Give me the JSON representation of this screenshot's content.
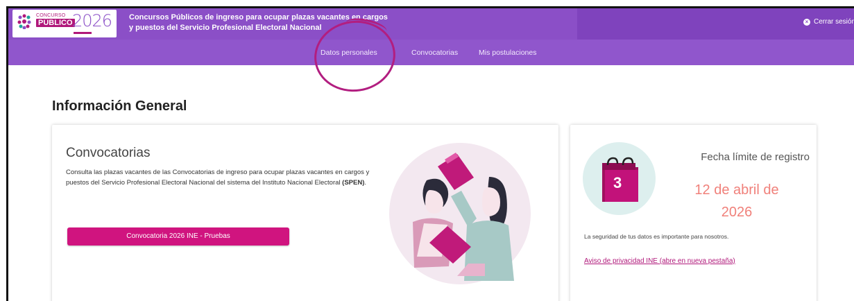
{
  "header": {
    "logo": {
      "concurso": "CONCURSO",
      "publico": "PÚBLICO",
      "year": "2026"
    },
    "title_line1": "Concursos Públicos de ingreso para ocupar plazas vacantes en cargos",
    "title_line2": "y puestos del Servicio Profesional Electoral Nacional",
    "logout_label": "Cerrar sesión",
    "logout_icon": "close-circle-icon"
  },
  "nav": {
    "items": [
      {
        "label": "Datos personales"
      },
      {
        "label": "Convocatorias"
      },
      {
        "label": "Mis postulaciones"
      }
    ]
  },
  "page": {
    "heading": "Información General"
  },
  "convocatorias_card": {
    "title": "Convocatorias",
    "description": "Consulta las plazas vacantes de las Convocatorias de ingreso para ocupar plazas vacantes en cargos y puestos del Servicio Profesional Electoral Nacional del sistema del Instituto Nacional Electoral",
    "description_bold": "(SPEN)",
    "description_end": ".",
    "button_label": "Convocatoria 2026 INE - Pruebas"
  },
  "deadline_card": {
    "calendar_day": "3",
    "label": "Fecha límite de registro",
    "date_line1": "12 de abril de",
    "date_line2": "2026",
    "privacy_note": "La seguridad de tus datos es importante para nosotros.",
    "privacy_link": "Aviso de privacidad INE (abre en nueva pestaña)"
  },
  "colors": {
    "header_purple": "#8b4fc7",
    "nav_purple": "#9056cc",
    "accent_magenta": "#d0147f",
    "annotation": "#b21e80",
    "date_salmon": "#f0807a"
  }
}
